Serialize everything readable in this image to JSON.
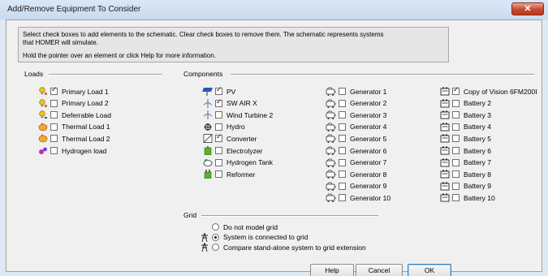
{
  "window": {
    "title": "Add/Remove Equipment To Consider",
    "close_glyph": "✕"
  },
  "info": {
    "line1": "Select check boxes to add elements to the schematic. Clear check boxes to remove them. The schematic represents systems",
    "line2": "that HOMER will simulate.",
    "line3": "Hold the pointer over an element or click Help for more information."
  },
  "loads": {
    "label": "Loads",
    "items": [
      {
        "label": "Primary Load 1",
        "checked": true,
        "icon": "bulb-person-icon"
      },
      {
        "label": "Primary Load 2",
        "checked": false,
        "icon": "bulb-person-icon"
      },
      {
        "label": "Deferrable Load",
        "checked": false,
        "icon": "deferrable-load-icon"
      },
      {
        "label": "Thermal Load 1",
        "checked": false,
        "icon": "thermal-load-icon"
      },
      {
        "label": "Thermal Load 2",
        "checked": false,
        "icon": "thermal-load-icon"
      },
      {
        "label": "Hydrogen load",
        "checked": false,
        "icon": "hydrogen-load-icon"
      }
    ]
  },
  "components": {
    "label": "Components",
    "items": [
      {
        "label": "PV",
        "checked": true,
        "icon": "pv-panel-icon"
      },
      {
        "label": "SW AIR X",
        "checked": true,
        "icon": "wind-turbine-icon"
      },
      {
        "label": "Wind Turbine 2",
        "checked": false,
        "icon": "wind-turbine-icon"
      },
      {
        "label": "Hydro",
        "checked": false,
        "icon": "hydro-icon"
      },
      {
        "label": "Converter",
        "checked": true,
        "icon": "converter-icon"
      },
      {
        "label": "Electrolyzer",
        "checked": false,
        "icon": "electrolyzer-icon"
      },
      {
        "label": "Hydrogen Tank",
        "checked": false,
        "icon": "hydrogen-tank-icon"
      },
      {
        "label": "Reformer",
        "checked": false,
        "icon": "reformer-icon"
      }
    ],
    "generators": [
      {
        "label": "Generator 1",
        "checked": false
      },
      {
        "label": "Generator 2",
        "checked": false
      },
      {
        "label": "Generator 3",
        "checked": false
      },
      {
        "label": "Generator 4",
        "checked": false
      },
      {
        "label": "Generator 5",
        "checked": false
      },
      {
        "label": "Generator 6",
        "checked": false
      },
      {
        "label": "Generator 7",
        "checked": false
      },
      {
        "label": "Generator 8",
        "checked": false
      },
      {
        "label": "Generator 9",
        "checked": false
      },
      {
        "label": "Generator 10",
        "checked": false
      }
    ],
    "batteries": [
      {
        "label": "Copy of Vision 6FM200I",
        "checked": true
      },
      {
        "label": "Battery 2",
        "checked": false
      },
      {
        "label": "Battery 3",
        "checked": false
      },
      {
        "label": "Battery 4",
        "checked": false
      },
      {
        "label": "Battery 5",
        "checked": false
      },
      {
        "label": "Battery 6",
        "checked": false
      },
      {
        "label": "Battery 7",
        "checked": false
      },
      {
        "label": "Battery 8",
        "checked": false
      },
      {
        "label": "Battery 9",
        "checked": false
      },
      {
        "label": "Battery 10",
        "checked": false
      }
    ]
  },
  "grid": {
    "label": "Grid",
    "options": [
      {
        "label": "Do not model grid",
        "selected": false,
        "icon": ""
      },
      {
        "label": "System is connected to grid",
        "selected": true,
        "icon": "grid-tower-icon"
      },
      {
        "label": "Compare stand-alone system to grid extension",
        "selected": false,
        "icon": "grid-tower-icon"
      }
    ]
  },
  "buttons": {
    "help": "Help",
    "cancel": "Cancel",
    "ok": "OK"
  }
}
